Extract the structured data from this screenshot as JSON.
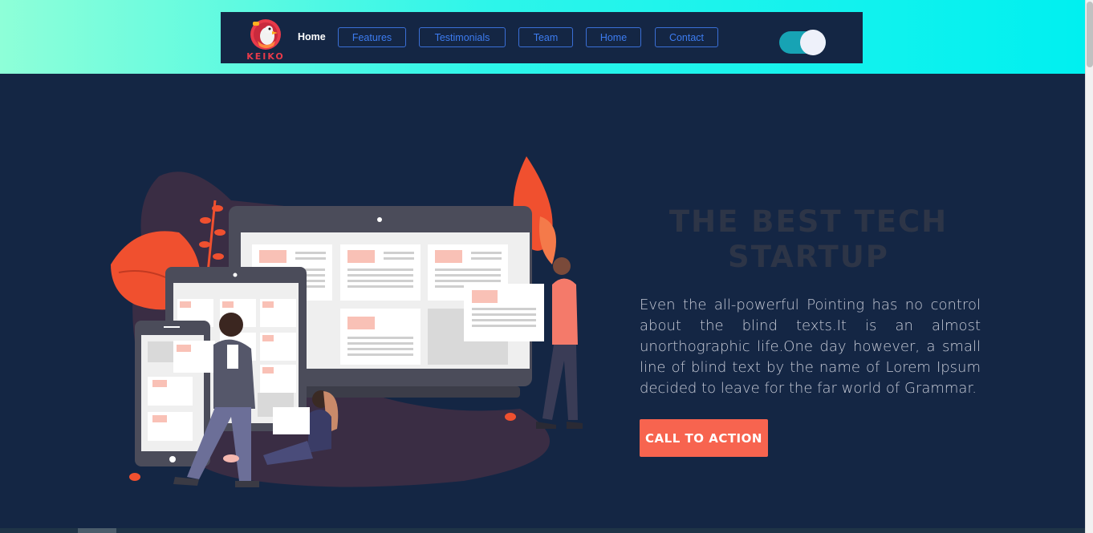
{
  "logo": {
    "text": "KEIKO"
  },
  "nav": {
    "active_label": "Home",
    "buttons": [
      "Features",
      "Testimonials",
      "Team",
      "Home",
      "Contact"
    ]
  },
  "hero": {
    "title_line1": "THE BEST TECH",
    "title_line2": "STARTUP",
    "body": "Even the all-powerful Pointing has no control about the blind texts.It is an almost unorthographic life.One day however, a small line of blind text by the name of Lorem Ipsum decided to leave for the far world of Grammar.",
    "cta_label": "CALL TO ACTION"
  },
  "theme_toggle": {
    "on": true
  },
  "colors": {
    "background": "#142644",
    "accent": "#f7644f",
    "nav_link": "#3d7cf0",
    "band_start": "#8effd8",
    "band_end": "#00f0f0"
  }
}
